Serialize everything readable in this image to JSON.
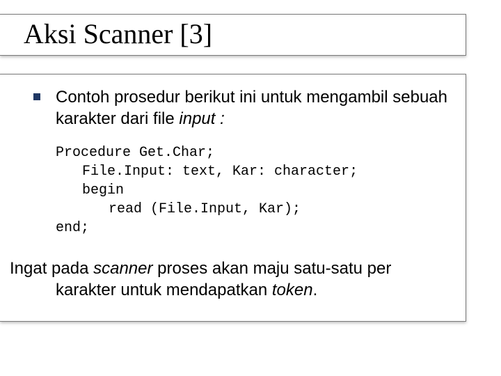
{
  "title": "Aksi Scanner [3]",
  "bullet": {
    "text_a": "Contoh prosedur berikut ini untuk mengambil sebuah karakter dari file ",
    "italic": "input :"
  },
  "code": {
    "l1": "Procedure Get.Char;",
    "l2": "File.Input: text, Kar: character;",
    "l3": "begin",
    "l4": "read (File.Input, Kar);",
    "l5": "end;"
  },
  "conclusion": {
    "a": "Ingat pada ",
    "b": "scanner",
    "c": " proses akan maju satu-satu per karakter untuk mendapatkan ",
    "d": "token",
    "e": "."
  }
}
